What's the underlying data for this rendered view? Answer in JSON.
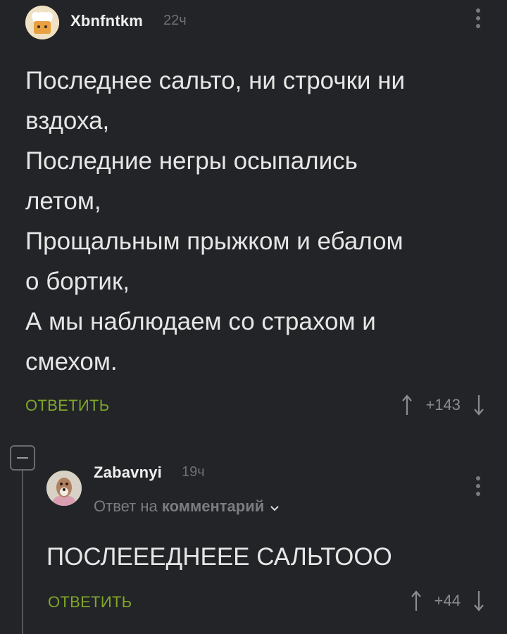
{
  "comments": [
    {
      "username": "Xbnfntkm",
      "time": "22ч",
      "text": "Последнее сальто, ни строчки ни\nвздоха,\nПоследние негры осыпались\nлетом,\nПрощальным прыжком и ебалом\nо бортик,\nА мы наблюдаем со страхом и\nсмехом.",
      "reply_label": "ОТВЕТИТЬ",
      "rating": "+143"
    },
    {
      "username": "Zabavnyi",
      "time": "19ч",
      "reply_to_prefix": "Ответ на",
      "reply_to_target": "комментарий",
      "text": "ПОСЛЕЕЕДНЕЕЕ САЛЬТООО",
      "reply_label": "ОТВЕТИТЬ",
      "rating": "+44"
    }
  ],
  "colors": {
    "background": "#232427",
    "reply_button": "#7ea72a",
    "muted": "#7b7c80"
  }
}
